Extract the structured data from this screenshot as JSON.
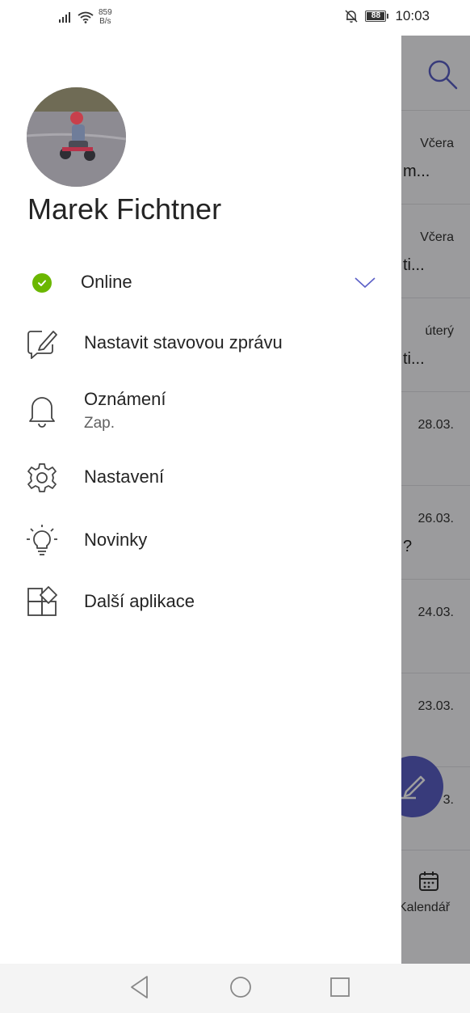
{
  "status_bar": {
    "speed_value": "859",
    "speed_unit": "B/s",
    "battery": "88",
    "time": "10:03",
    "icons": [
      "signal-icon",
      "wifi-icon",
      "bell-off-icon",
      "battery-icon"
    ]
  },
  "drawer": {
    "user_name": "Marek Fichtner",
    "presence": {
      "label": "Online",
      "color": "#6bb700"
    },
    "items": [
      {
        "label": "Nastavit stavovou zprávu",
        "icon": "edit-status-icon"
      },
      {
        "label": "Oznámení",
        "sub": "Zap.",
        "icon": "bell-icon"
      },
      {
        "label": "Nastavení",
        "icon": "gear-icon"
      },
      {
        "label": "Novinky",
        "icon": "lightbulb-icon"
      },
      {
        "label": "Další aplikace",
        "icon": "apps-icon"
      }
    ]
  },
  "background_app": {
    "rows": [
      {
        "date": "Včera",
        "snippet": "m..."
      },
      {
        "date": "Včera",
        "snippet": "ti..."
      },
      {
        "date": "úterý",
        "snippet": "ti..."
      },
      {
        "date": "28.03.",
        "snippet": ""
      },
      {
        "date": "26.03.",
        "snippet": "?"
      },
      {
        "date": "24.03.",
        "snippet": ""
      },
      {
        "date": "23.03.",
        "snippet": ""
      },
      {
        "date": "3.",
        "snippet": ""
      }
    ],
    "bottom_tab_label": "Kalendář",
    "accent_color": "#5b5fc7"
  },
  "nav_bar": {
    "icons": [
      "back-icon",
      "home-icon",
      "recents-icon"
    ]
  }
}
